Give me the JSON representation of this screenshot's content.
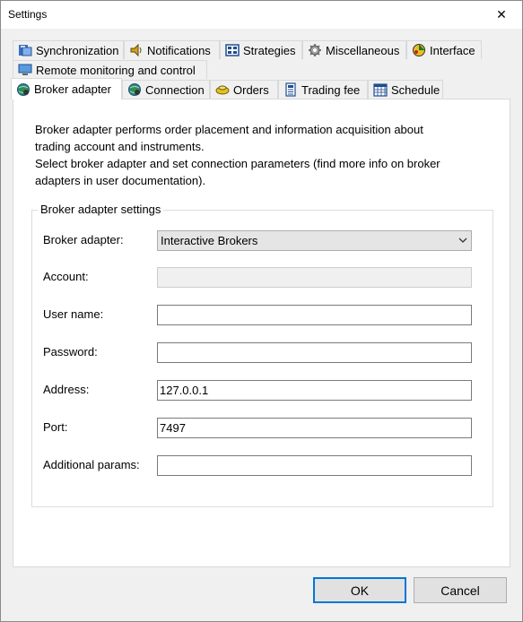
{
  "window": {
    "title": "Settings"
  },
  "tabs": {
    "row1": [
      {
        "label": "Synchronization",
        "icon": "sync-icon"
      },
      {
        "label": "Notifications",
        "icon": "speaker-icon"
      },
      {
        "label": "Strategies",
        "icon": "strategies-icon"
      },
      {
        "label": "Miscellaneous",
        "icon": "gear-icon"
      },
      {
        "label": "Interface",
        "icon": "interface-icon"
      }
    ],
    "row2": [
      {
        "label": "Remote monitoring and control",
        "icon": "monitor-icon"
      }
    ],
    "row3": [
      {
        "label": "Broker adapter",
        "icon": "globe-icon",
        "active": true
      },
      {
        "label": "Connection",
        "icon": "globe-icon"
      },
      {
        "label": "Orders",
        "icon": "orders-icon"
      },
      {
        "label": "Trading fee",
        "icon": "calculator-icon"
      },
      {
        "label": "Schedule",
        "icon": "calendar-icon"
      }
    ]
  },
  "description": {
    "line1": "Broker adapter performs order placement and information acquisition about",
    "line2": "trading account and instruments.",
    "line3": "Select broker adapter and set connection parameters (find more info on broker",
    "line4": "adapters in user documentation)."
  },
  "group": {
    "title": "Broker adapter settings",
    "broker_adapter": {
      "label": "Broker adapter:",
      "value": "Interactive Brokers"
    },
    "account": {
      "label": "Account:",
      "value": ""
    },
    "user_name": {
      "label": "User name:",
      "value": ""
    },
    "password": {
      "label": "Password:",
      "value": ""
    },
    "address": {
      "label": "Address:",
      "value": "127.0.0.1"
    },
    "port": {
      "label": "Port:",
      "value": "7497"
    },
    "additional_params": {
      "label": "Additional params:",
      "value": ""
    }
  },
  "buttons": {
    "ok": "OK",
    "cancel": "Cancel"
  },
  "colors": {
    "accent": "#0078d7",
    "dialog_bg": "#f0f0f0",
    "panel_bg": "#ffffff"
  }
}
